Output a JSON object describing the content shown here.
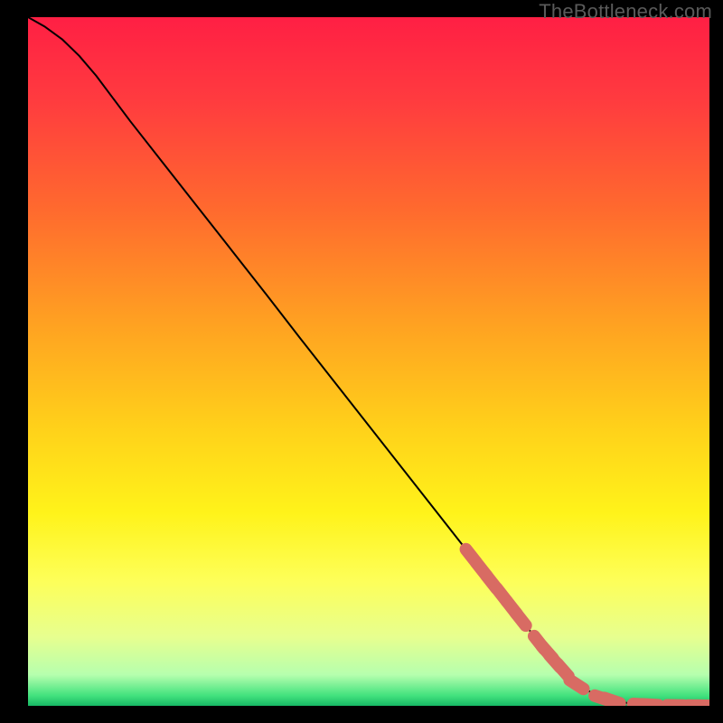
{
  "watermark": "TheBottleneck.com",
  "colors": {
    "gradient_stops": [
      {
        "offset": 0.0,
        "color": "#ff1f44"
      },
      {
        "offset": 0.12,
        "color": "#ff3b3f"
      },
      {
        "offset": 0.28,
        "color": "#ff6a2e"
      },
      {
        "offset": 0.45,
        "color": "#ffa321"
      },
      {
        "offset": 0.6,
        "color": "#ffd21a"
      },
      {
        "offset": 0.72,
        "color": "#fff31a"
      },
      {
        "offset": 0.82,
        "color": "#fdff5a"
      },
      {
        "offset": 0.9,
        "color": "#e7ff8f"
      },
      {
        "offset": 0.955,
        "color": "#b6ffae"
      },
      {
        "offset": 0.985,
        "color": "#43e27e"
      },
      {
        "offset": 1.0,
        "color": "#17b864"
      }
    ],
    "curve": "#000000",
    "marker_fill": "#d86b63",
    "marker_stroke": "#d86b63"
  },
  "chart_data": {
    "type": "line",
    "title": "",
    "xlabel": "",
    "ylabel": "",
    "xlim": [
      0,
      100
    ],
    "ylim": [
      0,
      100
    ],
    "grid": false,
    "legend": false,
    "series": [
      {
        "name": "curve",
        "x": [
          0.0,
          2.5,
          5.0,
          7.5,
          10.0,
          12.5,
          15.0,
          20.0,
          25.0,
          30.0,
          35.0,
          40.0,
          45.0,
          50.0,
          55.0,
          60.0,
          65.0,
          70.0,
          75.0,
          80.0,
          83.0,
          86.0,
          89.0,
          92.0,
          95.0,
          100.0
        ],
        "y": [
          100.0,
          98.6,
          96.8,
          94.4,
          91.5,
          88.2,
          84.9,
          78.6,
          72.3,
          66.0,
          59.7,
          53.3,
          47.0,
          40.7,
          34.4,
          28.1,
          21.8,
          15.5,
          9.2,
          3.6,
          1.7,
          0.7,
          0.25,
          0.1,
          0.05,
          0.0
        ]
      }
    ],
    "markers": [
      {
        "x": 65.0,
        "y": 21.8
      },
      {
        "x": 66.5,
        "y": 19.9
      },
      {
        "x": 68.0,
        "y": 18.0
      },
      {
        "x": 69.5,
        "y": 16.15
      },
      {
        "x": 71.0,
        "y": 14.25
      },
      {
        "x": 72.3,
        "y": 12.6
      },
      {
        "x": 75.0,
        "y": 9.2
      },
      {
        "x": 76.2,
        "y": 7.8
      },
      {
        "x": 77.3,
        "y": 6.5
      },
      {
        "x": 78.5,
        "y": 5.2
      },
      {
        "x": 80.5,
        "y": 3.1
      },
      {
        "x": 84.3,
        "y": 1.1
      },
      {
        "x": 85.7,
        "y": 0.75
      },
      {
        "x": 90.0,
        "y": 0.2
      },
      {
        "x": 91.3,
        "y": 0.15
      },
      {
        "x": 95.0,
        "y": 0.05
      },
      {
        "x": 98.0,
        "y": 0.02
      },
      {
        "x": 99.3,
        "y": 0.01
      }
    ]
  }
}
